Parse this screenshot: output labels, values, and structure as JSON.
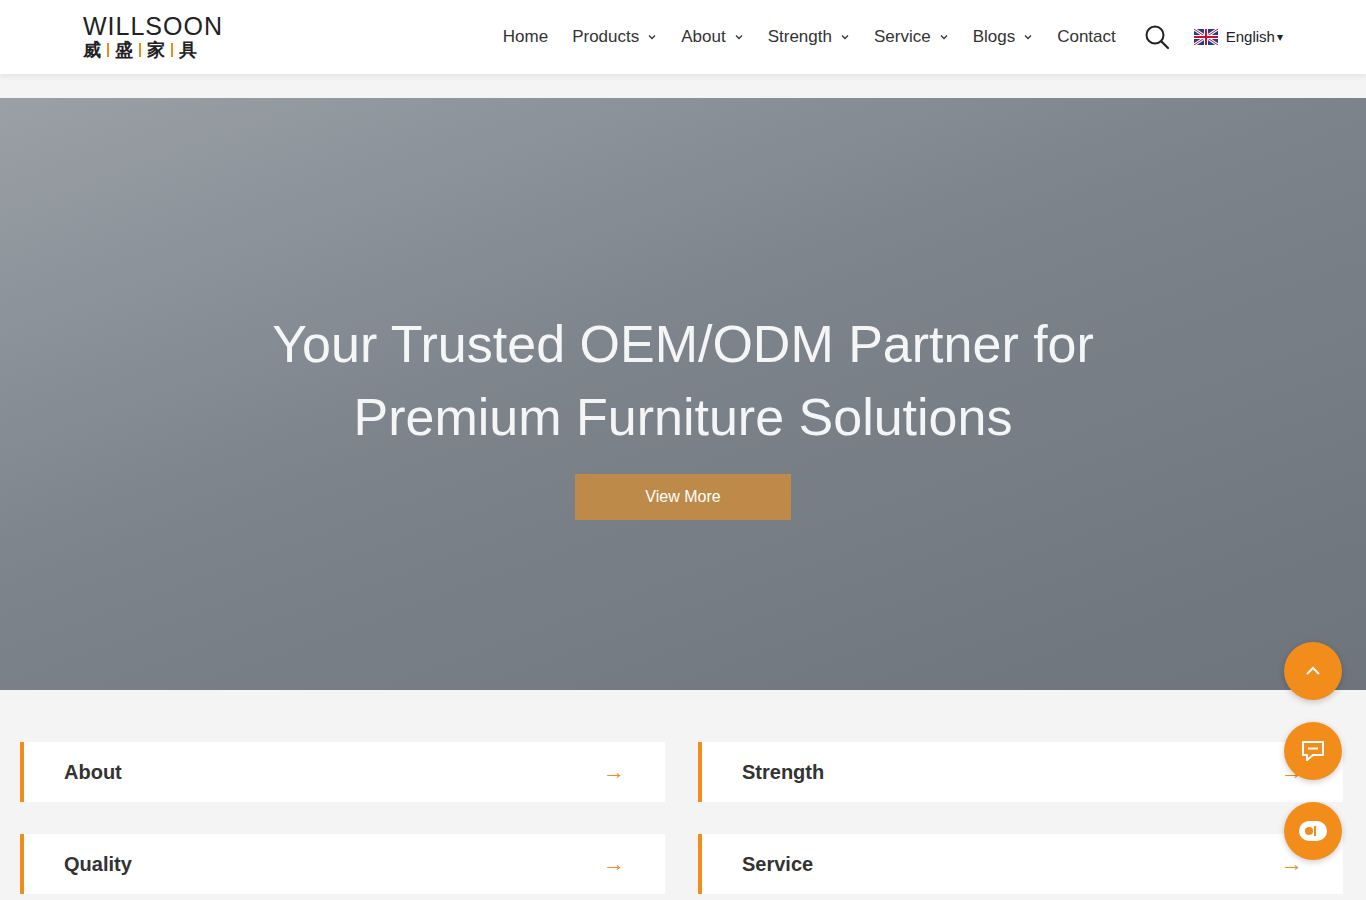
{
  "header": {
    "logo": {
      "wordmark": "WILLSOON",
      "chinese": [
        "威",
        "盛",
        "家",
        "具"
      ]
    },
    "nav": [
      {
        "label": "Home",
        "dropdown": false
      },
      {
        "label": "Products",
        "dropdown": true
      },
      {
        "label": "About",
        "dropdown": true
      },
      {
        "label": "Strength",
        "dropdown": true
      },
      {
        "label": "Service",
        "dropdown": true
      },
      {
        "label": "Blogs",
        "dropdown": true
      },
      {
        "label": "Contact",
        "dropdown": false
      }
    ],
    "language": {
      "label": "English",
      "caret": "▾"
    }
  },
  "hero": {
    "headline": [
      "Your Trusted OEM/ODM Partner for",
      "Premium Furniture Solutions"
    ],
    "button": "View More"
  },
  "cards": [
    {
      "label": "About",
      "arrow": "→"
    },
    {
      "label": "Strength",
      "arrow": "→"
    },
    {
      "label": "Quality",
      "arrow": "→"
    },
    {
      "label": "Service",
      "arrow": "→"
    }
  ]
}
